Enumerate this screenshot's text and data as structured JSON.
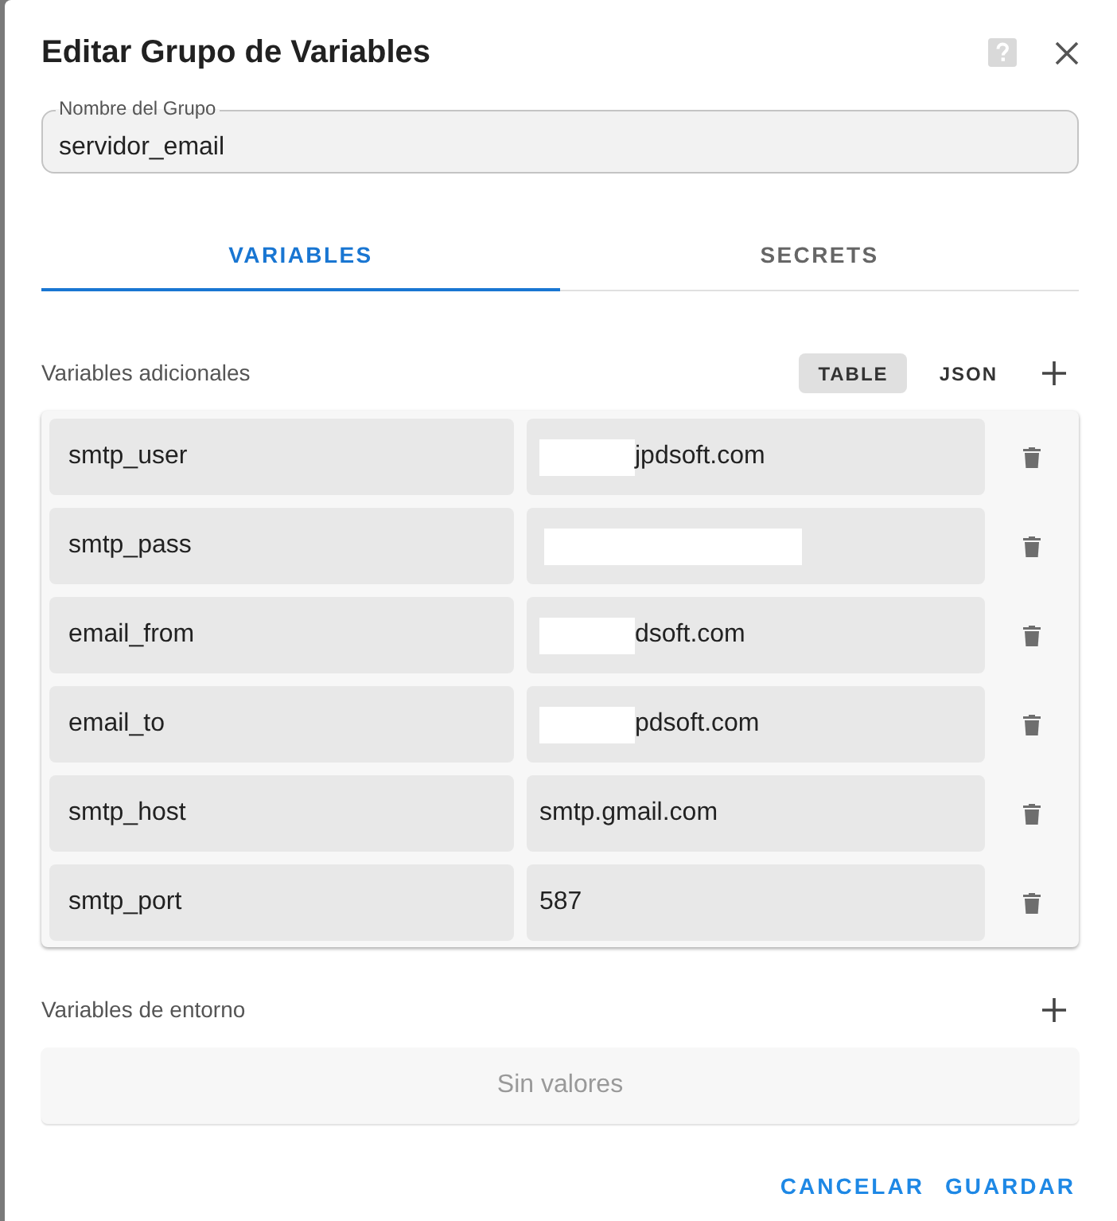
{
  "dialog": {
    "title": "Editar Grupo de Variables"
  },
  "group_name": {
    "label": "Nombre del Grupo",
    "value": "servidor_email"
  },
  "tabs": [
    {
      "label": "VARIABLES",
      "selected": true
    },
    {
      "label": "SECRETS",
      "selected": false
    }
  ],
  "additional_variables": {
    "title": "Variables adicionales",
    "view_modes": [
      {
        "label": "TABLE",
        "selected": true
      },
      {
        "label": "JSON",
        "selected": false
      }
    ],
    "rows": [
      {
        "name": "smtp_user",
        "value": "jpdsoft.com",
        "redacted": true
      },
      {
        "name": "smtp_pass",
        "redacted": true
      },
      {
        "name": "email_from",
        "value": "dsoft.com",
        "redacted": true
      },
      {
        "name": "email_to",
        "value": "pdsoft.com",
        "redacted": true
      },
      {
        "name": "smtp_host",
        "value": "smtp.gmail.com",
        "redacted": false
      },
      {
        "name": "smtp_port",
        "value": "587",
        "redacted": false
      }
    ]
  },
  "environment_variables": {
    "title": "Variables de entorno",
    "empty_text": "Sin valores"
  },
  "buttons": [
    {
      "label": "CANCELAR"
    },
    {
      "label": "GUARDAR"
    }
  ]
}
